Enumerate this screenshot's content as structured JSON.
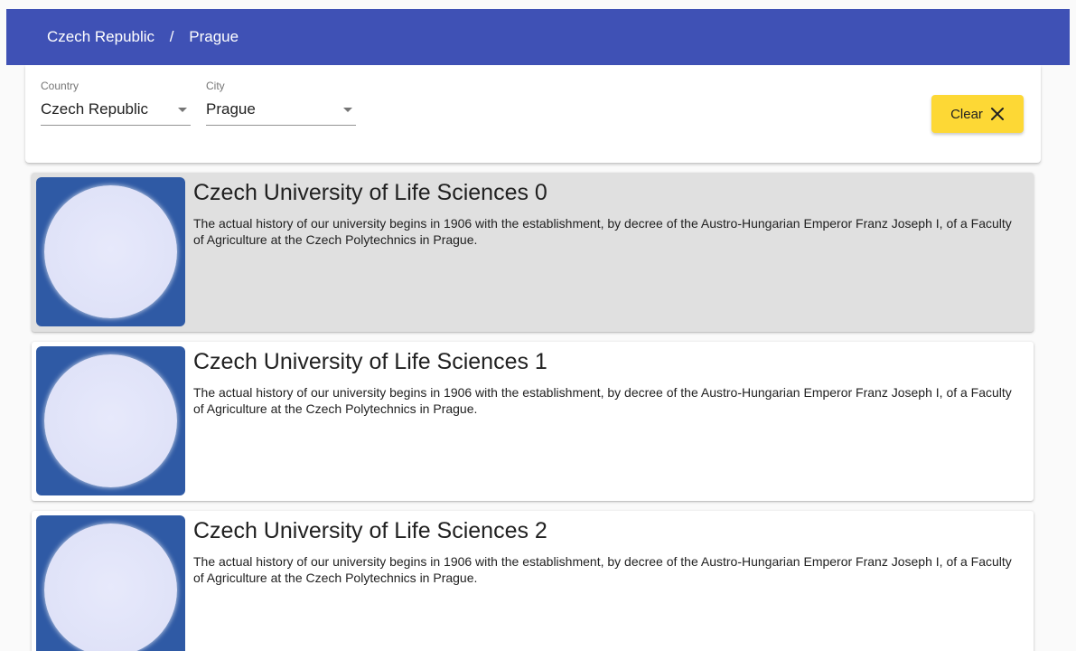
{
  "breadcrumb": {
    "country": "Czech Republic",
    "separator": "/",
    "city": "Prague"
  },
  "filters": {
    "country": {
      "label": "Country",
      "value": "Czech Republic"
    },
    "city": {
      "label": "City",
      "value": "Prague"
    },
    "clear_label": "Clear"
  },
  "results": [
    {
      "title": "Czech University of Life Sciences 0",
      "description": "The actual history of our university begins in 1906 with the establishment, by decree of the Austro-Hungarian Emperor Franz Joseph I, of a Faculty of Agriculture at the Czech Polytechnics in Prague."
    },
    {
      "title": "Czech University of Life Sciences 1",
      "description": "The actual history of our university begins in 1906 with the establishment, by decree of the Austro-Hungarian Emperor Franz Joseph I, of a Faculty of Agriculture at the Czech Polytechnics in Prague."
    },
    {
      "title": "Czech University of Life Sciences 2",
      "description": "The actual history of our university begins in 1906 with the establishment, by decree of the Austro-Hungarian Emperor Franz Joseph I, of a Faculty of Agriculture at the Czech Polytechnics in Prague."
    }
  ],
  "colors": {
    "toolbar": "#3f51b5",
    "accent_button": "#fdd835",
    "thumbnail": "#2f5aa5",
    "selected_row": "#e0e0e0"
  },
  "icons": {
    "clear": "close-icon",
    "dropdown": "arrow-drop-down-icon",
    "thumbnail": "university-logo-placeholder"
  }
}
